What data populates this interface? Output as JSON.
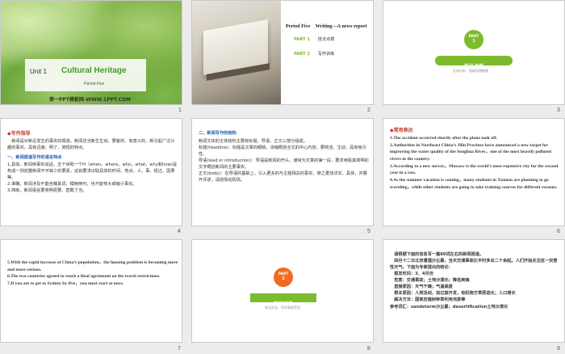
{
  "slides": [
    {
      "num": "1",
      "title": "Unit 1",
      "title2": "Cultural Heritage",
      "subtitle": "Period Five",
      "footer": "第一PPT模板网-WWW.1PPT.COM"
    },
    {
      "num": "2",
      "title": "Period Five　Writing—A news report",
      "items": [
        {
          "part": "PART 1",
          "label": "技法点拨"
        },
        {
          "part": "PART 2",
          "label": "写作训练"
        }
      ]
    },
    {
      "num": "3",
      "part": "PART",
      "part_no": "1",
      "banner": "技法点拨",
      "caption": "文体分析　思维导图梳理"
    },
    {
      "num": "4",
      "heading": "◆写作指导",
      "p1": "　新闻是对新近发生的事实的报道。新闻应当新生生动、要客的、有意义的、新引起广泛兴趣的事实，具有迅速、明了、简短的特点。",
      "h2": "一、新闻报道写作的语言特点",
      "lines": [
        "1.具体。新闻用事实说话，五个W和一个H（when，where，who，what，why和how)是构成一则完整新闻不可缺少的要素，这就要求识取具体的时间、地点、人、事、经过、因果等。",
        "2.准确。新闻涉及不能含糊其词，模棱两可，也不能夸大或缩小事实。",
        "3.简练。新闻语言要简明扼要、直截了当。"
      ]
    },
    {
      "num": "5",
      "h": "二、新闻写作的结构",
      "lines": [
        "新闻文体的主体结构主要有标题、导语、正文三部分组成。",
        "标题(headline)：标题是文章的眼睛，浓缩概括全文的中心内容，要简洁、生动、具有吸引性。",
        "导语(lead or introduction)：导语是新闻的开头，通常为文章的第一段，要求用极其简明的文字概括新闻的主要事实。",
        "正文(body)：在导语的基础上，引入更多的与主题相关的事实，使之更加详实、具体，并展开评述，请前情动情情。"
      ]
    },
    {
      "num": "6",
      "heading": "◆常用表达",
      "lines": [
        "1.The accident occurred shortly after the plane took off.",
        "2.Authorities in Northeast China’s Jilin Province have announced a new target for improving the water quality of the Songhua River，one of the most heavily polluted rivers in the country.",
        "3.According to a new survey，Moscow is the world’s most expensive city for the second year in a row.",
        "4.As the summer vacation is coming，many students in Xiamen are planning to go traveling，while other students are going to take training courses for different reasons."
      ]
    },
    {
      "num": "7",
      "lines": [
        "5.With the rapid increase of China’s population，the housing problem is becoming more and more serious.",
        "6.The two countries agreed to reach a final agreement on the travel restrictions.",
        "7.If you are to get to Sydney by five，you must start at once."
      ]
    },
    {
      "num": "8",
      "part": "PART",
      "part_no": "2",
      "banner": "写作训练",
      "caption": "牢记方法　写作表现范式"
    },
    {
      "num": "9",
      "lines": [
        "　请根据下面的信息写一篇80词左右的新闻报道。",
        "　四月十二日北京遭遇沙尘暴，当天交通事故比平时多出二十余起。人们开始关注这一灾害性天气。下面为专家提出的结论：",
        "　报发时间：3、4月份",
        "　危害：交通事故；土地沙漠化；降低疾病",
        "　直接原因：天气干燥；气温高度",
        "　根本原因：人类活动，如过度开发，有机物方草原退化；人口增长",
        "　解决方法：国家应植树种草利用浓度等",
        "参考词汇：sandstorm沙尘暴；desertification土地沙漠化"
      ]
    }
  ],
  "colors": {
    "green": "#7dbb2e",
    "red": "#d9302a",
    "blue": "#2a5db0",
    "part_circle": "#f26a21"
  }
}
